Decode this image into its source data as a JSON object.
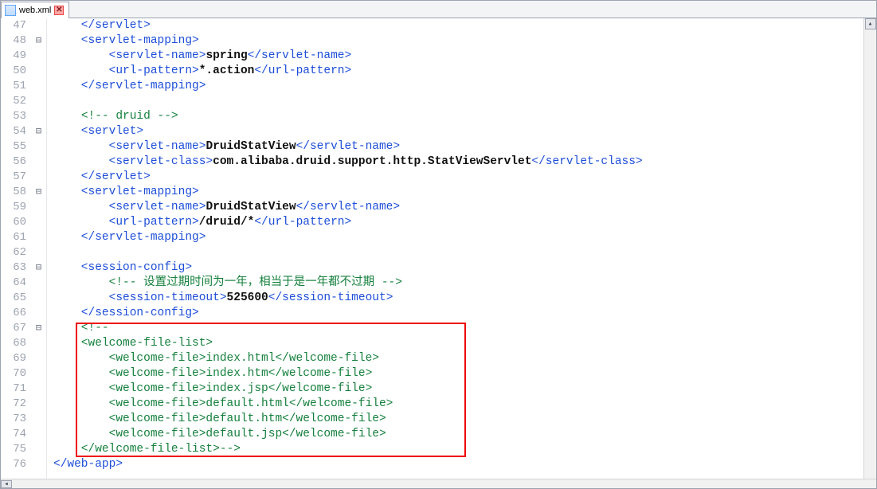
{
  "tab": {
    "filename": "web.xml",
    "close_glyph": "✕"
  },
  "scroll": {
    "up": "▴",
    "down": "▾",
    "left": "◂",
    "right": "▸"
  },
  "lines": [
    {
      "n": 47,
      "fold": "",
      "seg": [
        {
          "c": "tag",
          "t": "    </servlet>"
        }
      ]
    },
    {
      "n": 48,
      "fold": "⊟",
      "seg": [
        {
          "c": "tag",
          "t": "    <servlet-mapping>"
        }
      ]
    },
    {
      "n": 49,
      "fold": "",
      "seg": [
        {
          "c": "tag",
          "t": "        <servlet-name>"
        },
        {
          "c": "txt",
          "t": "spring"
        },
        {
          "c": "tag",
          "t": "</servlet-name>"
        }
      ]
    },
    {
      "n": 50,
      "fold": "",
      "seg": [
        {
          "c": "tag",
          "t": "        <url-pattern>"
        },
        {
          "c": "txt",
          "t": "*.action"
        },
        {
          "c": "tag",
          "t": "</url-pattern>"
        }
      ]
    },
    {
      "n": 51,
      "fold": "",
      "seg": [
        {
          "c": "tag",
          "t": "    </servlet-mapping>"
        }
      ]
    },
    {
      "n": 52,
      "fold": "",
      "seg": [
        {
          "c": "plain",
          "t": ""
        }
      ]
    },
    {
      "n": 53,
      "fold": "",
      "seg": [
        {
          "c": "plain",
          "t": "    "
        },
        {
          "c": "cmt",
          "t": "<!-- druid -->"
        }
      ]
    },
    {
      "n": 54,
      "fold": "⊟",
      "seg": [
        {
          "c": "tag",
          "t": "    <servlet>"
        }
      ]
    },
    {
      "n": 55,
      "fold": "",
      "seg": [
        {
          "c": "tag",
          "t": "        <servlet-name>"
        },
        {
          "c": "txt",
          "t": "DruidStatView"
        },
        {
          "c": "tag",
          "t": "</servlet-name>"
        }
      ]
    },
    {
      "n": 56,
      "fold": "",
      "seg": [
        {
          "c": "tag",
          "t": "        <servlet-class>"
        },
        {
          "c": "txt",
          "t": "com.alibaba.druid.support.http.StatViewServlet"
        },
        {
          "c": "tag",
          "t": "</servlet-class>"
        }
      ]
    },
    {
      "n": 57,
      "fold": "",
      "seg": [
        {
          "c": "tag",
          "t": "    </servlet>"
        }
      ]
    },
    {
      "n": 58,
      "fold": "⊟",
      "seg": [
        {
          "c": "tag",
          "t": "    <servlet-mapping>"
        }
      ]
    },
    {
      "n": 59,
      "fold": "",
      "seg": [
        {
          "c": "tag",
          "t": "        <servlet-name>"
        },
        {
          "c": "txt",
          "t": "DruidStatView"
        },
        {
          "c": "tag",
          "t": "</servlet-name>"
        }
      ]
    },
    {
      "n": 60,
      "fold": "",
      "seg": [
        {
          "c": "tag",
          "t": "        <url-pattern>"
        },
        {
          "c": "txt",
          "t": "/druid/*"
        },
        {
          "c": "tag",
          "t": "</url-pattern>"
        }
      ]
    },
    {
      "n": 61,
      "fold": "",
      "seg": [
        {
          "c": "tag",
          "t": "    </servlet-mapping>"
        }
      ]
    },
    {
      "n": 62,
      "fold": "",
      "seg": [
        {
          "c": "plain",
          "t": ""
        }
      ]
    },
    {
      "n": 63,
      "fold": "⊟",
      "seg": [
        {
          "c": "tag",
          "t": "    <session-config>"
        }
      ]
    },
    {
      "n": 64,
      "fold": "",
      "seg": [
        {
          "c": "plain",
          "t": "        "
        },
        {
          "c": "cmt",
          "t": "<!-- 设置过期时间为一年，相当于是一年都不过期 -->"
        }
      ]
    },
    {
      "n": 65,
      "fold": "",
      "seg": [
        {
          "c": "tag",
          "t": "        <session-timeout>"
        },
        {
          "c": "txt",
          "t": "525600"
        },
        {
          "c": "tag",
          "t": "</session-timeout>"
        }
      ]
    },
    {
      "n": 66,
      "fold": "",
      "seg": [
        {
          "c": "tag",
          "t": "    </session-config>"
        }
      ]
    },
    {
      "n": 67,
      "fold": "⊟",
      "seg": [
        {
          "c": "cmt",
          "t": "    <!--"
        }
      ]
    },
    {
      "n": 68,
      "fold": "",
      "seg": [
        {
          "c": "cmt",
          "t": "    <welcome-file-list>"
        }
      ]
    },
    {
      "n": 69,
      "fold": "",
      "seg": [
        {
          "c": "cmt",
          "t": "        <welcome-file>index.html</welcome-file>"
        }
      ]
    },
    {
      "n": 70,
      "fold": "",
      "seg": [
        {
          "c": "cmt",
          "t": "        <welcome-file>index.htm</welcome-file>"
        }
      ]
    },
    {
      "n": 71,
      "fold": "",
      "seg": [
        {
          "c": "cmt",
          "t": "        <welcome-file>index.jsp</welcome-file>"
        }
      ]
    },
    {
      "n": 72,
      "fold": "",
      "seg": [
        {
          "c": "cmt",
          "t": "        <welcome-file>default.html</welcome-file>"
        }
      ]
    },
    {
      "n": 73,
      "fold": "",
      "seg": [
        {
          "c": "cmt",
          "t": "        <welcome-file>default.htm</welcome-file>"
        }
      ]
    },
    {
      "n": 74,
      "fold": "",
      "seg": [
        {
          "c": "cmt",
          "t": "        <welcome-file>default.jsp</welcome-file>"
        }
      ]
    },
    {
      "n": 75,
      "fold": "",
      "seg": [
        {
          "c": "cmt",
          "t": "    </welcome-file-list>-->"
        }
      ]
    },
    {
      "n": 76,
      "fold": "",
      "seg": [
        {
          "c": "tag",
          "t": "</web-app>"
        }
      ]
    }
  ],
  "redbox": {
    "top_line": 67,
    "bottom_line": 75
  }
}
